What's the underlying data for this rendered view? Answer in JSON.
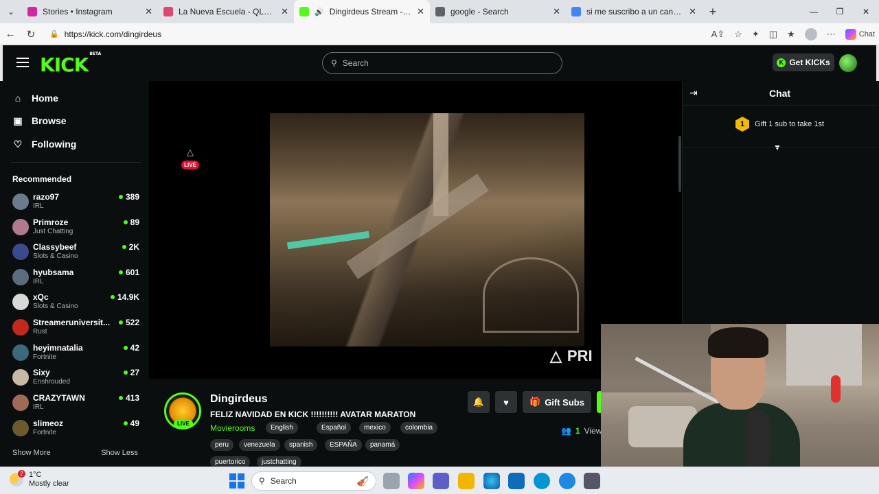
{
  "browser": {
    "tabs": [
      {
        "title": "Stories • Instagram",
        "color": "#d6249f",
        "active": false
      },
      {
        "title": "La Nueva Escuela - QLOO* (Video",
        "color": "#e0476b",
        "active": false
      },
      {
        "title": "Dingirdeus Stream - Watch Live",
        "color": "#53fc18",
        "active": true
      },
      {
        "title": "google - Search",
        "color": "#5f6368",
        "active": false
      },
      {
        "title": "si me suscribo a un canal de kick n",
        "color": "#4285f4",
        "active": false
      }
    ],
    "url": "https://kick.com/dingirdeus",
    "chat_button": "Chat"
  },
  "kick": {
    "logo": "KICK",
    "logo_badge": "BETA",
    "search_placeholder": "Search",
    "get_kicks": "Get KICKs",
    "nav": {
      "home": "Home",
      "browse": "Browse",
      "following": "Following"
    },
    "recommended_title": "Recommended",
    "recommended": [
      {
        "name": "razo97",
        "category": "IRL",
        "viewers": "389",
        "color": "#6b7b8c"
      },
      {
        "name": "Primroze",
        "category": "Just Chatting",
        "viewers": "89",
        "color": "#b07a8e"
      },
      {
        "name": "Classybeef",
        "category": "Slots & Casino",
        "viewers": "2K",
        "color": "#3b4a8a"
      },
      {
        "name": "hyubsama",
        "category": "IRL",
        "viewers": "601",
        "color": "#5a6c7d"
      },
      {
        "name": "xQc",
        "category": "Slots & Casino",
        "viewers": "14.9K",
        "color": "#d8d8d8"
      },
      {
        "name": "Streameruniversit...",
        "category": "Rust",
        "viewers": "522",
        "color": "#c4281c"
      },
      {
        "name": "heyimnatalia",
        "category": "Fortnite",
        "viewers": "42",
        "color": "#3c6a7a"
      },
      {
        "name": "Sixy",
        "category": "Enshrouded",
        "viewers": "27",
        "color": "#c7b9a4"
      },
      {
        "name": "CRAZYTAWN",
        "category": "IRL",
        "viewers": "413",
        "color": "#a06a58"
      },
      {
        "name": "slimeoz",
        "category": "Fortnite",
        "viewers": "49",
        "color": "#6a5a2e"
      }
    ],
    "show_more": "Show More",
    "show_less": "Show Less",
    "player": {
      "live_label": "LIVE",
      "watermark": "PRI"
    },
    "channel": {
      "name": "Dingirdeus",
      "title": "FELIZ NAVIDAD EN KICK !!!!!!!!!! AVATAR MARATON",
      "category": "Movierooms",
      "live_label": "LIVE",
      "tags": [
        "English",
        "Español",
        "mexico",
        "colombia",
        "peru",
        "venezuela",
        "spanish",
        "ESPAÑA",
        "panamá",
        "puertorico",
        "justchatting"
      ],
      "gift_subs": "Gift Subs",
      "viewers_count": "1",
      "viewers_label": "Viewe"
    },
    "chat": {
      "title": "Chat",
      "gift_prompt": "Gift 1 sub to take 1st",
      "gift_rank": "1"
    }
  },
  "taskbar": {
    "temp": "1°C",
    "condition": "Mostly clear",
    "notif_count": "2",
    "search_placeholder": "Search"
  }
}
